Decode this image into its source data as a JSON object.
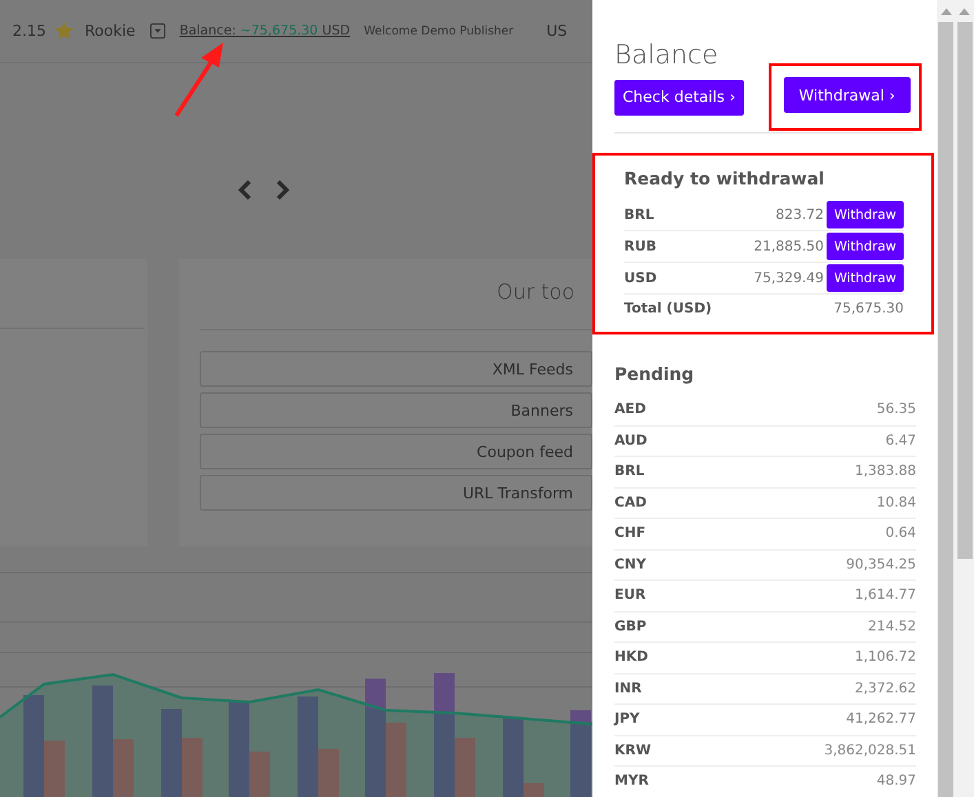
{
  "header": {
    "rating": "2.15",
    "level": "Rookie",
    "balance_label": "Balance:",
    "balance_amount": "~75,675.30",
    "balance_currency": "USD",
    "welcome": "Welcome Demo Publisher",
    "currency": "US"
  },
  "tools_card": {
    "title": "Our too",
    "buttons": [
      "XML Feeds",
      "Banners",
      "Coupon feed",
      "URL Transform"
    ]
  },
  "balance_panel": {
    "title": "Balance",
    "buttons": [
      "Check details ›",
      "Withdrawal ›"
    ],
    "ready": {
      "title": "Ready to withdrawal",
      "rows": [
        {
          "currency": "BRL",
          "amount": "823.72",
          "button": "Withdraw"
        },
        {
          "currency": "RUB",
          "amount": "21,885.50",
          "button": "Withdraw"
        },
        {
          "currency": "USD",
          "amount": "75,329.49",
          "button": "Withdraw"
        }
      ],
      "total_label": "Total (USD)",
      "total": "75,675.30"
    },
    "pending": {
      "title": "Pending",
      "rows": [
        {
          "currency": "AED",
          "amount": "56.35"
        },
        {
          "currency": "AUD",
          "amount": "6.47"
        },
        {
          "currency": "BRL",
          "amount": "1,383.88"
        },
        {
          "currency": "CAD",
          "amount": "10.84"
        },
        {
          "currency": "CHF",
          "amount": "0.64"
        },
        {
          "currency": "CNY",
          "amount": "90,354.25"
        },
        {
          "currency": "EUR",
          "amount": "1,614.77"
        },
        {
          "currency": "GBP",
          "amount": "214.52"
        },
        {
          "currency": "HKD",
          "amount": "1,106.72"
        },
        {
          "currency": "INR",
          "amount": "2,372.62"
        },
        {
          "currency": "JPY",
          "amount": "41,262.77"
        },
        {
          "currency": "KRW",
          "amount": "3,862,028.51"
        },
        {
          "currency": "MYR",
          "amount": "48.97"
        }
      ]
    }
  }
}
